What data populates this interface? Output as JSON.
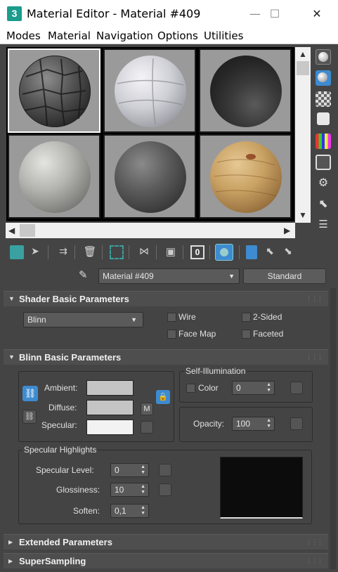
{
  "window": {
    "app_icon_letter": "3",
    "title": "Material Editor - Material #409",
    "minimize_glyph": "—",
    "maximize_glyph": "☐",
    "close_glyph": "✕"
  },
  "menu": [
    "Modes",
    "Material",
    "Navigation",
    "Options",
    "Utilities"
  ],
  "slots": [
    {
      "name": "stone-paving",
      "active": true
    },
    {
      "name": "white-plaster",
      "active": false
    },
    {
      "name": "dark-gray",
      "active": false
    },
    {
      "name": "gray-concrete",
      "active": false
    },
    {
      "name": "dark-stone",
      "active": false
    },
    {
      "name": "wood",
      "active": false
    }
  ],
  "material": {
    "name": "Material #409",
    "type_button": "Standard",
    "dropper_icon": "eyedropper-icon"
  },
  "shader_rollout": {
    "title": "Shader Basic Parameters",
    "shader": "Blinn",
    "options": [
      {
        "label": "Wire",
        "checked": false
      },
      {
        "label": "2-Sided",
        "checked": false
      },
      {
        "label": "Face Map",
        "checked": false
      },
      {
        "label": "Faceted",
        "checked": false
      }
    ]
  },
  "blinn_rollout": {
    "title": "Blinn Basic Parameters",
    "ambient_label": "Ambient:",
    "diffuse_label": "Diffuse:",
    "specular_label": "Specular:",
    "ambient_color": "#c4c4c4",
    "diffuse_color": "#c4c4c4",
    "specular_color": "#f2f2f2",
    "map_button": "M",
    "self_illum_title": "Self-Illumination",
    "self_illum_color_label": "Color",
    "self_illum_value": "0",
    "opacity_label": "Opacity:",
    "opacity_value": "100",
    "spec_highlights_title": "Specular Highlights",
    "specular_level_label": "Specular Level:",
    "specular_level_value": "0",
    "glossiness_label": "Glossiness:",
    "glossiness_value": "10",
    "soften_label": "Soften:",
    "soften_value": "0,1"
  },
  "extended_rollout": {
    "title": "Extended Parameters"
  },
  "supersampling_rollout": {
    "title": "SuperSampling"
  }
}
